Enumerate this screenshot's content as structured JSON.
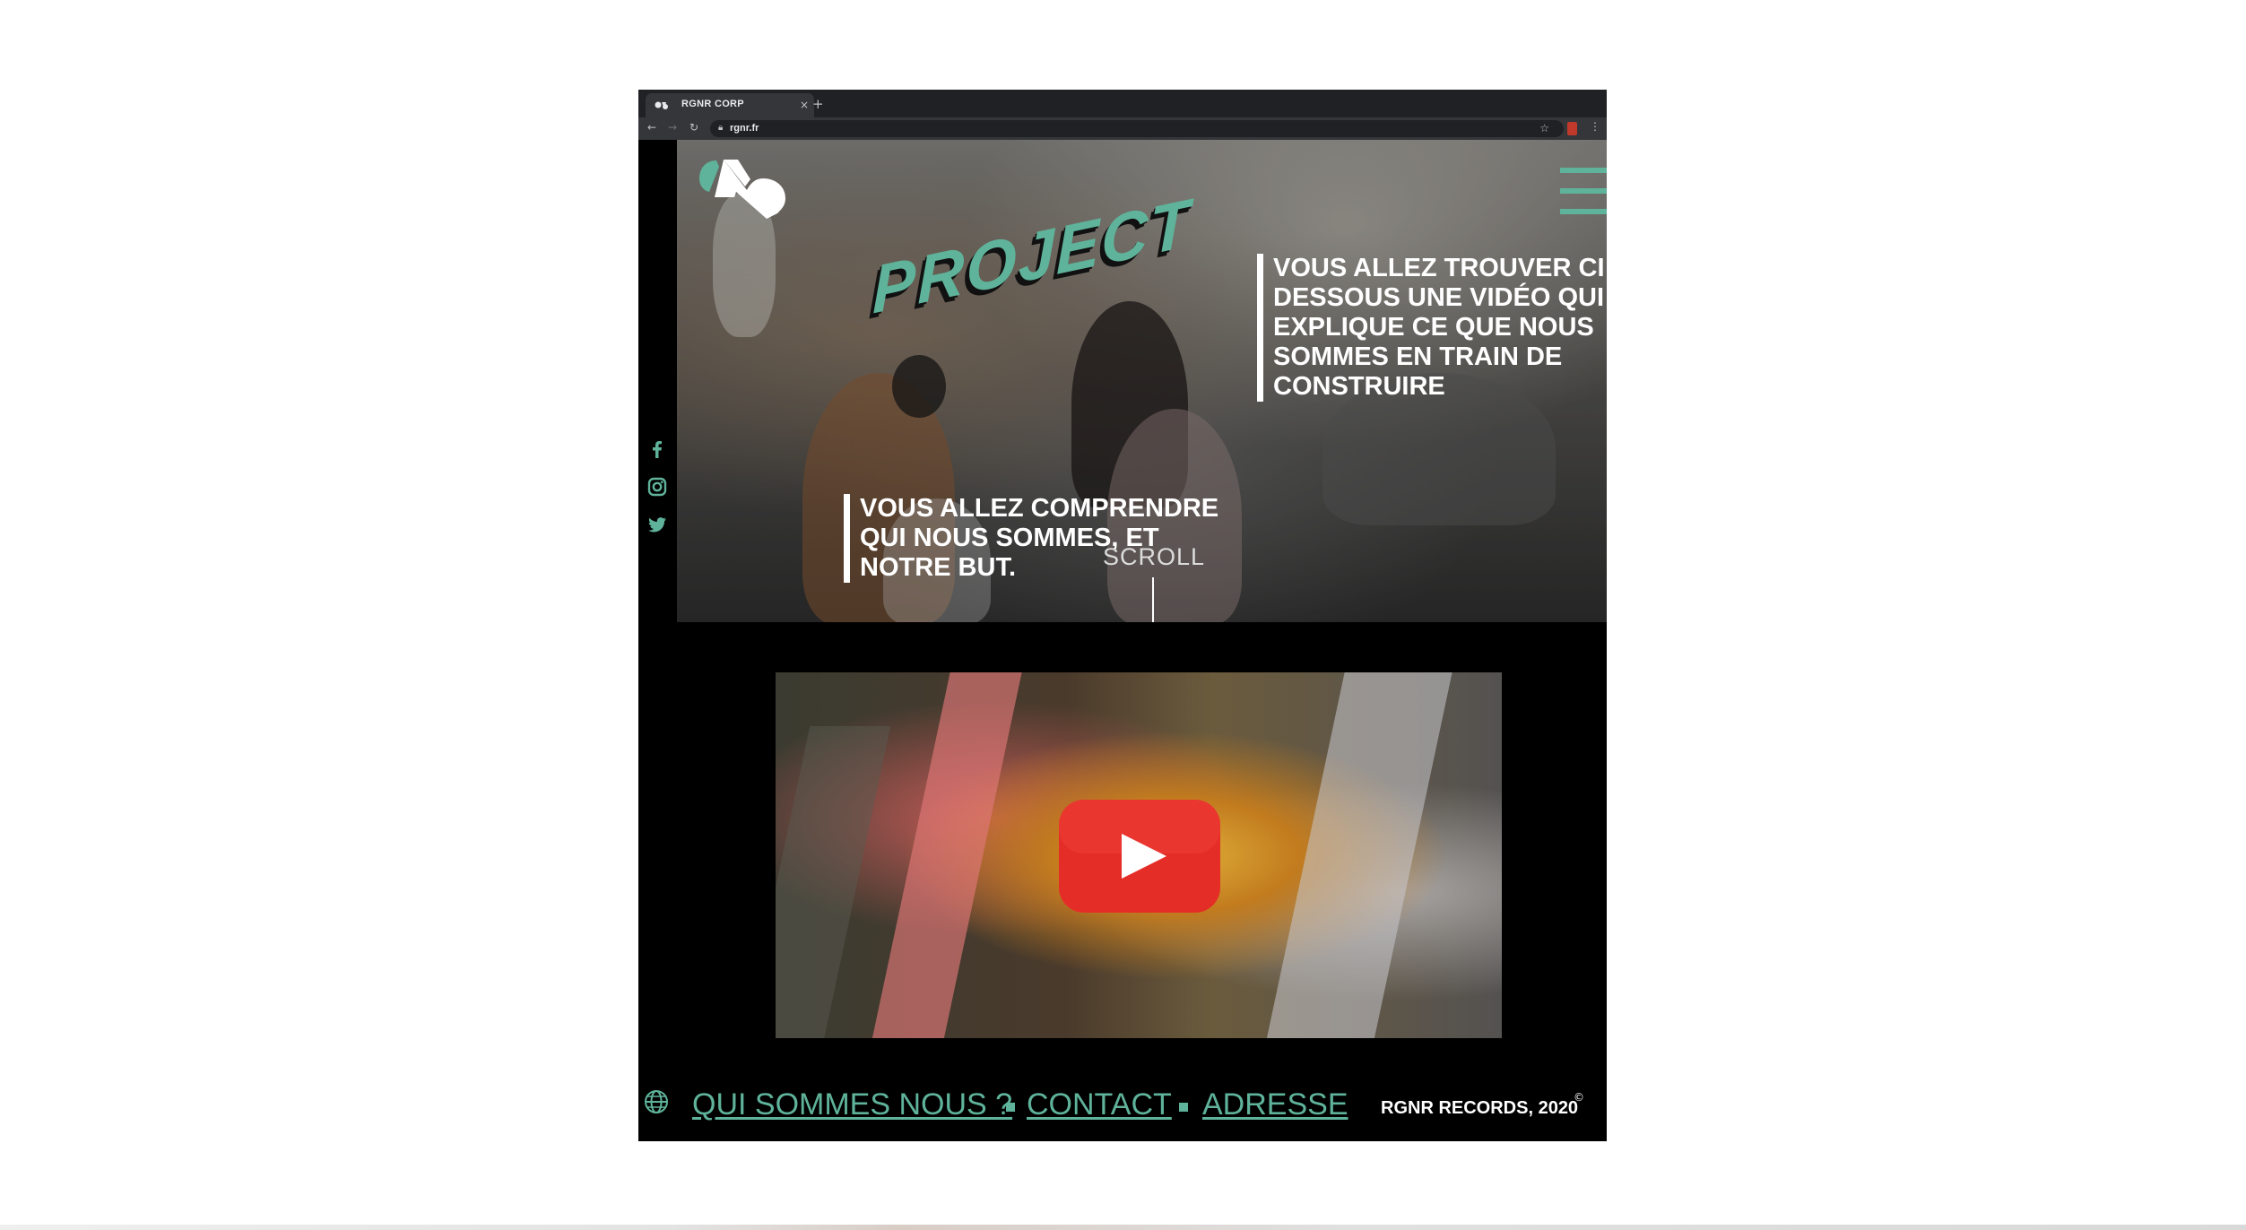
{
  "browser": {
    "tab_title": "RGNR CORP",
    "tab_close": "×",
    "new_tab": "+",
    "back": "←",
    "forward": "→",
    "reload": "↻",
    "url": "rgnr.fr",
    "bookmark": "☆",
    "menu": "⋮"
  },
  "hero": {
    "project_title": "PROJECT",
    "right_text": "VOUS ALLEZ TROUVER CI DESSOUS UNE VIDÉO QUI EXPLIQUE CE QUE NOUS SOMMES EN TRAIN DE CONSTRUIRE",
    "left_text": "VOUS ALLEZ COMPRENDRE QUI NOUS SOMMES, ET NOTRE BUT.",
    "scroll_label": "SCROLL"
  },
  "social": {
    "icons": [
      "facebook-icon",
      "instagram-icon",
      "twitter-icon"
    ]
  },
  "video": {
    "play_icon": "youtube-play-icon"
  },
  "footer": {
    "nav": [
      "QUI SOMMES NOUS ?",
      "CONTACT",
      "ADRESSE"
    ],
    "copyright": "RGNR RECORDS, 2020",
    "copyright_mark": "©"
  },
  "colors": {
    "accent": "#5fb39a",
    "background": "#000000",
    "text": "#ffffff"
  }
}
